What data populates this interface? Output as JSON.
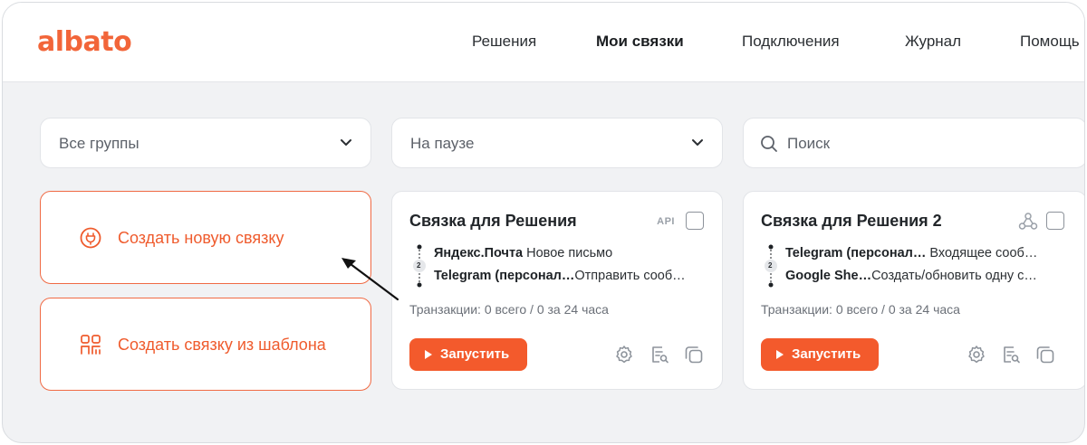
{
  "brand": {
    "logo_text": "albato",
    "accent_color": "#f35a2c"
  },
  "nav": {
    "items": [
      {
        "label": "Решения",
        "active": false
      },
      {
        "label": "Мои связки",
        "active": true
      },
      {
        "label": "Подключения",
        "active": false
      },
      {
        "label": "Журнал",
        "active": false
      },
      {
        "label": "Помощь",
        "active": false
      }
    ]
  },
  "filters": {
    "group_select": {
      "value": "Все группы",
      "icon": "chevron-down-icon"
    },
    "status_select": {
      "value": "На паузе",
      "icon": "chevron-down-icon"
    },
    "search": {
      "placeholder": "Поиск",
      "icon": "search-icon"
    }
  },
  "actions": {
    "create_new": {
      "label": "Создать новую связку",
      "icon": "plug-icon"
    },
    "create_from_template": {
      "label": "Создать связку из шаблона",
      "icon": "template-icon"
    }
  },
  "cards": [
    {
      "title": "Связка для Решения",
      "badge": "API",
      "steps": [
        {
          "app": "Яндекс.Почта",
          "action": "Новое письмо"
        },
        {
          "app": "Telegram (персонал…",
          "action": "Отправить сооб…"
        }
      ],
      "step_number": "2",
      "transactions": "Транзакции: 0 всего / 0 за 24 часа",
      "run_label": "Запустить"
    },
    {
      "title": "Связка для Решения 2",
      "badge_icon": "webhook-icon",
      "steps": [
        {
          "app": "Telegram (персонал…",
          "action": "Входящее сооб…"
        },
        {
          "app": "Google She…",
          "action": "Создать/обновить одну с…"
        }
      ],
      "step_number": "2",
      "transactions": "Транзакции: 0 всего / 0 за 24 часа",
      "run_label": "Запустить"
    }
  ]
}
